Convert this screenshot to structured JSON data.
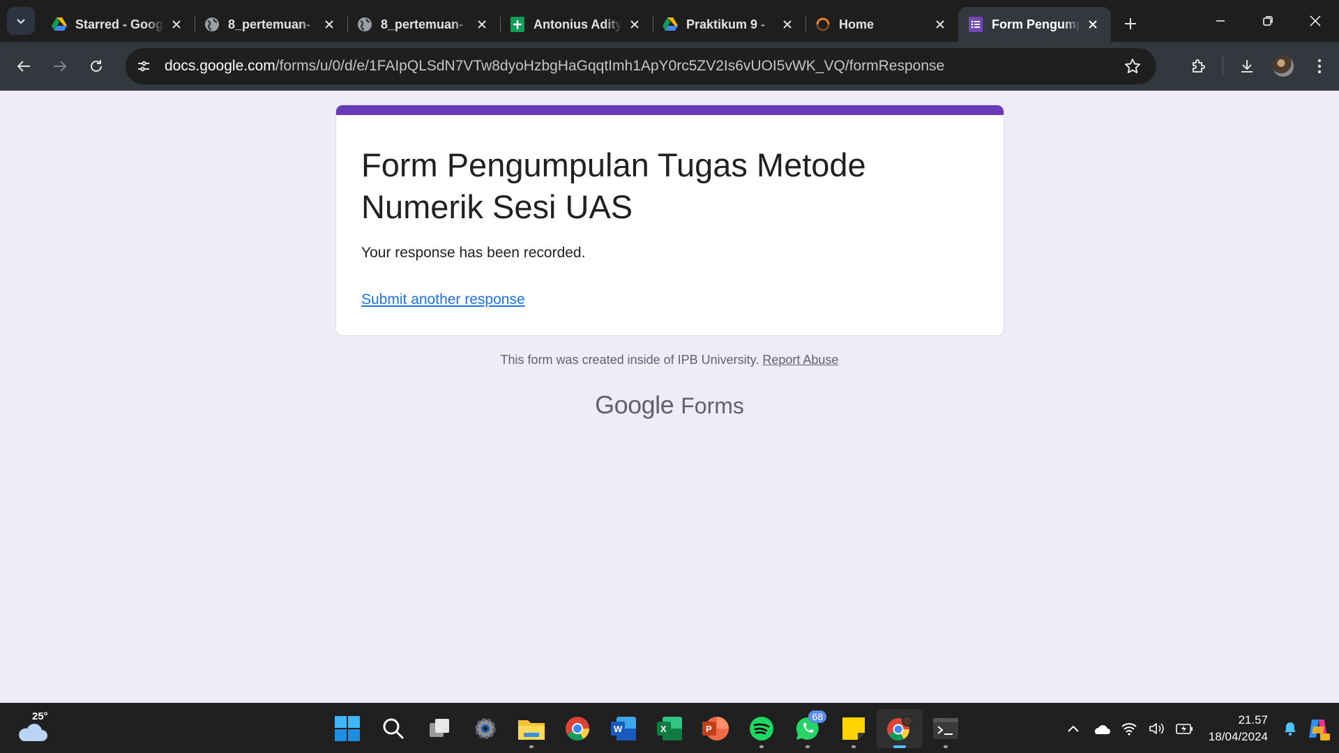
{
  "tabs": [
    {
      "title": "Starred - Google Drive",
      "icon": "google-drive-icon"
    },
    {
      "title": "8_pertemuan-",
      "icon": "globe-icon"
    },
    {
      "title": "8_pertemuan-",
      "icon": "globe-icon"
    },
    {
      "title": "Antonius Aditya",
      "icon": "google-sheets-icon"
    },
    {
      "title": "Praktikum 9 -",
      "icon": "google-drive-icon"
    },
    {
      "title": "Home",
      "icon": "loading-icon"
    },
    {
      "title": "Form Pengumpulan",
      "icon": "google-forms-icon",
      "active": true
    }
  ],
  "address_bar": {
    "host": "docs.google.com",
    "path": "/forms/u/0/d/e/1FAIpQLSdN7VTw8dyoHzbgHaGqqtImh1ApY0rc5ZV2Is6vUOI5vWK_VQ/formResponse"
  },
  "form": {
    "title": "Form Pengumpulan Tugas Metode Numerik Sesi UAS",
    "confirmation": "Your response has been recorded.",
    "another_link": "Submit another response"
  },
  "footer": {
    "note": "This form was created inside of IPB University.",
    "report": "Report Abuse",
    "brand_google": "Google",
    "brand_forms": "Forms"
  },
  "taskbar": {
    "weather_temp": "25°",
    "whatsapp_badge": "68",
    "time": "21.57",
    "date": "18/04/2024"
  },
  "colors": {
    "form_accent": "#673ab7",
    "link": "#1a73e8",
    "page_bg": "#f0ebf8"
  }
}
